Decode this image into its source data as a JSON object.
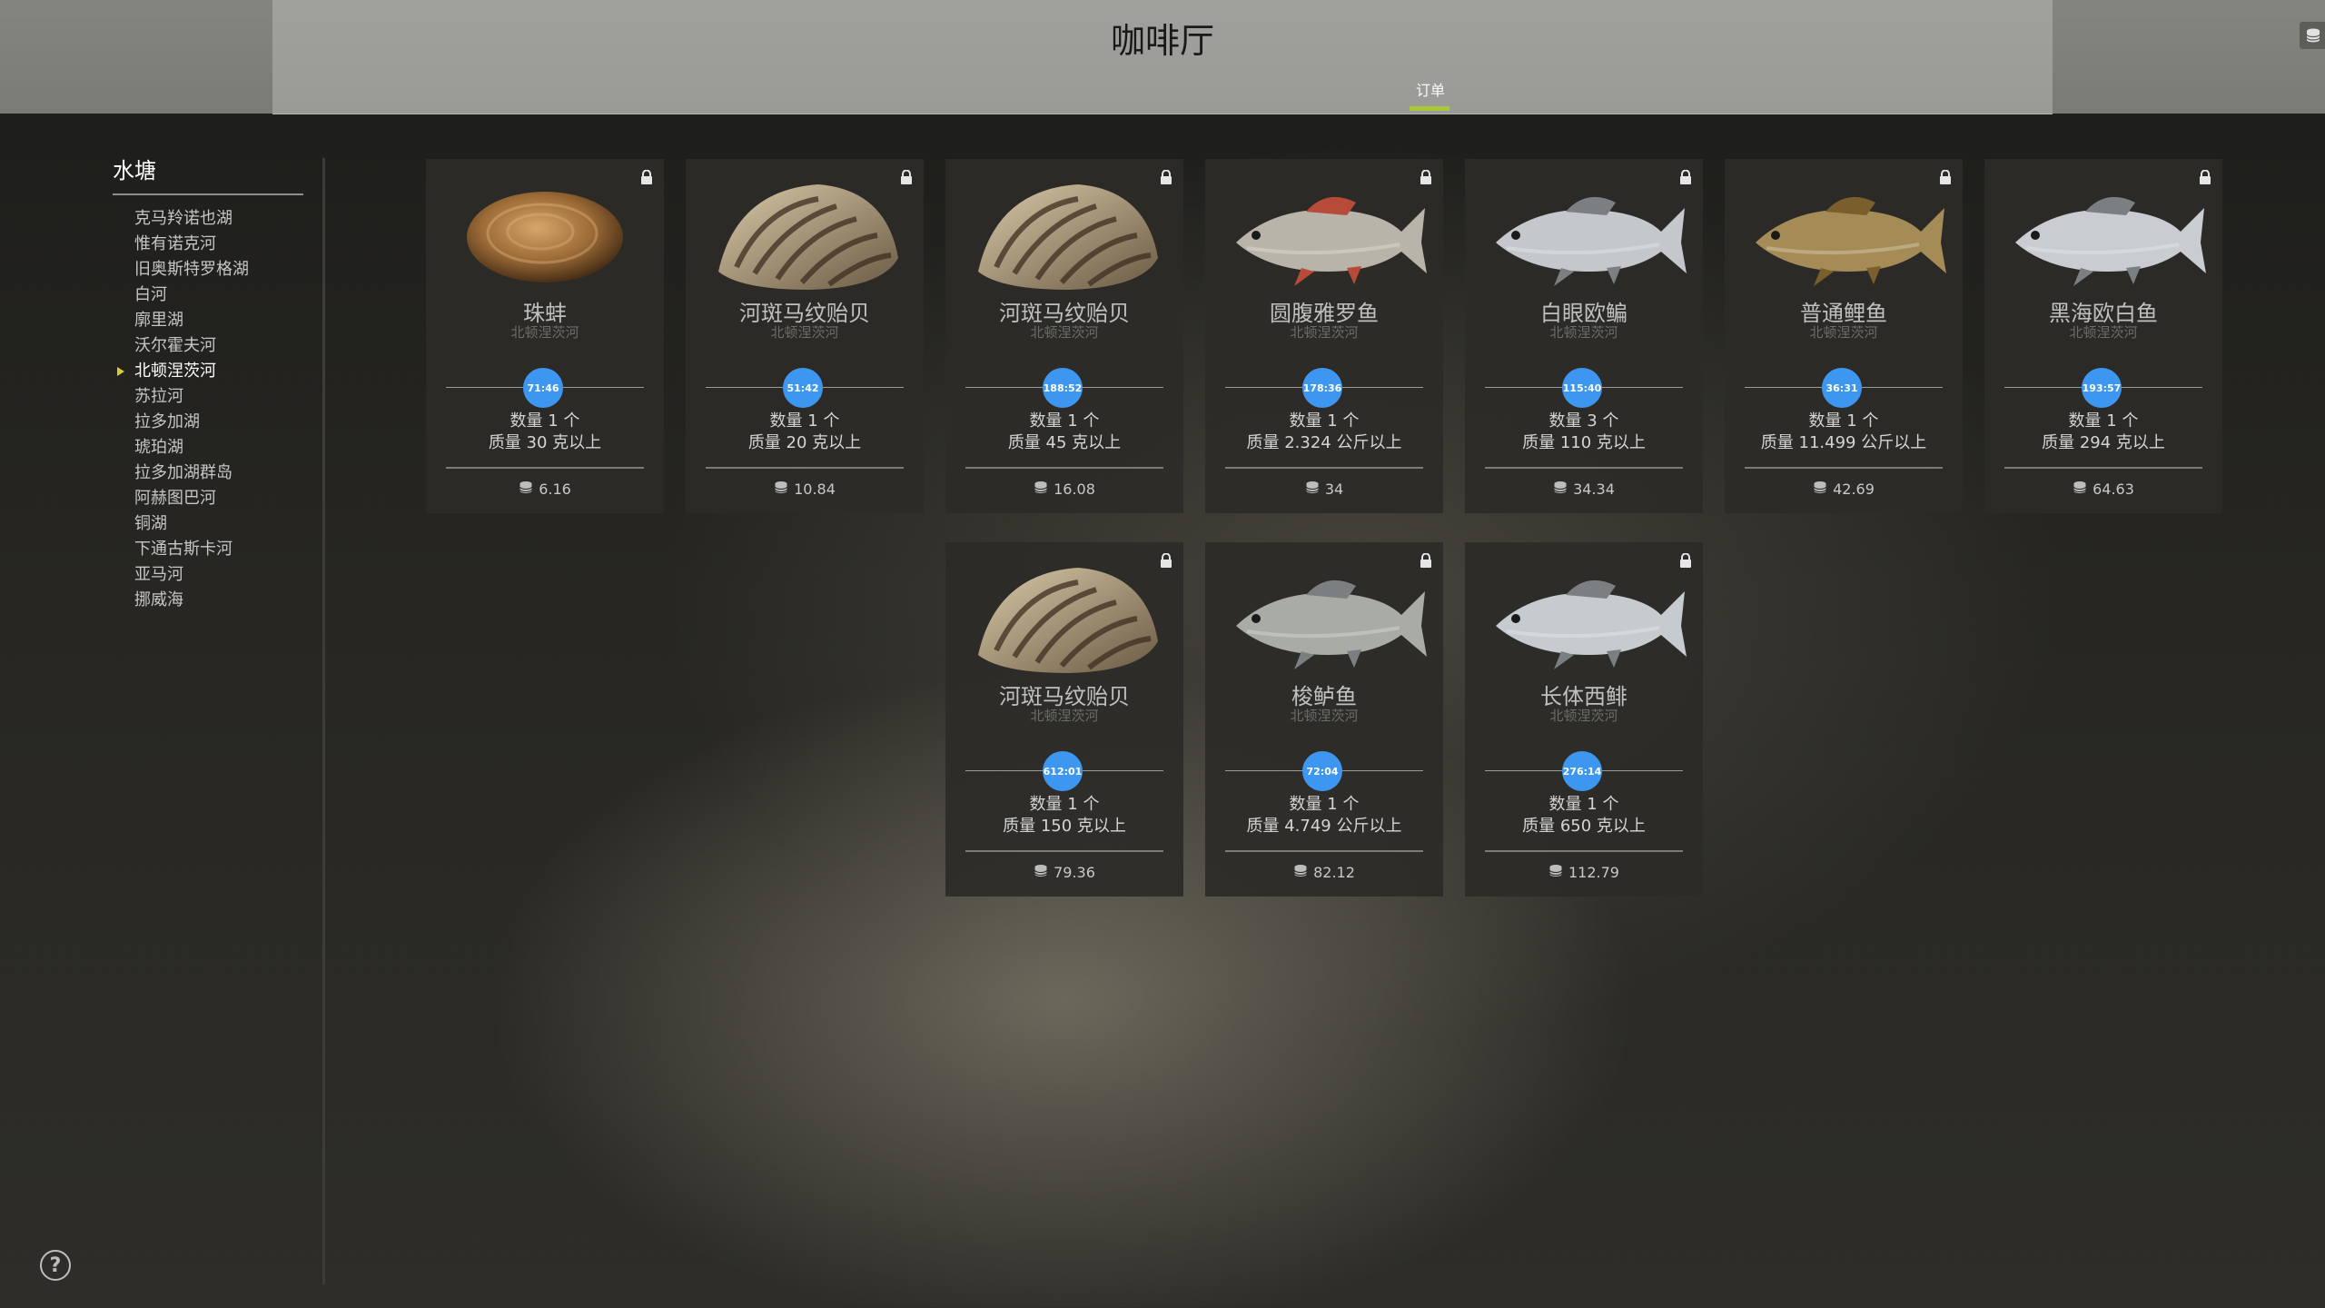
{
  "header": {
    "title": "咖啡厅",
    "tab_orders": "订单",
    "coin_icon": "coin-stack-icon"
  },
  "sidebar": {
    "title": "水塘",
    "items": [
      {
        "label": "克马羚诺也湖"
      },
      {
        "label": "惟有诺克河"
      },
      {
        "label": "旧奥斯特罗格湖"
      },
      {
        "label": "白河"
      },
      {
        "label": "廓里湖"
      },
      {
        "label": "沃尔霍夫河"
      },
      {
        "label": "北顿涅茨河"
      },
      {
        "label": "苏拉河"
      },
      {
        "label": "拉多加湖"
      },
      {
        "label": "琥珀湖"
      },
      {
        "label": "拉多加湖群岛"
      },
      {
        "label": "阿赫图巴河"
      },
      {
        "label": "铜湖"
      },
      {
        "label": "下通古斯卡河"
      },
      {
        "label": "亚马河"
      },
      {
        "label": "挪威海"
      }
    ],
    "active_index": 6
  },
  "orders": [
    {
      "name": "珠蚌",
      "location": "北顿涅茨河",
      "timer": "71:46",
      "quantity": "数量 1 个",
      "mass": "质量 30 克以上",
      "price": "6.16",
      "art": "clam"
    },
    {
      "name": "河斑马纹贻贝",
      "location": "北顿涅茨河",
      "timer": "51:42",
      "quantity": "数量 1 个",
      "mass": "质量 20 克以上",
      "price": "10.84",
      "art": "mussel"
    },
    {
      "name": "河斑马纹贻贝",
      "location": "北顿涅茨河",
      "timer": "188:52",
      "quantity": "数量 1 个",
      "mass": "质量 45 克以上",
      "price": "16.08",
      "art": "mussel"
    },
    {
      "name": "圆腹雅罗鱼",
      "location": "北顿涅茨河",
      "timer": "178:36",
      "quantity": "数量 1 个",
      "mass": "质量 2.324 公斤以上",
      "price": "34",
      "art": "roach"
    },
    {
      "name": "白眼欧鳊",
      "location": "北顿涅茨河",
      "timer": "115:40",
      "quantity": "数量 3 个",
      "mass": "质量 110 克以上",
      "price": "34.34",
      "art": "bream"
    },
    {
      "name": "普通鲤鱼",
      "location": "北顿涅茨河",
      "timer": "36:31",
      "quantity": "数量 1 个",
      "mass": "质量 11.499 公斤以上",
      "price": "42.69",
      "art": "carp"
    },
    {
      "name": "黑海欧白鱼",
      "location": "北顿涅茨河",
      "timer": "193:57",
      "quantity": "数量 1 个",
      "mass": "质量 294 克以上",
      "price": "64.63",
      "art": "bleak"
    },
    {
      "name": "河斑马纹贻贝",
      "location": "北顿涅茨河",
      "timer": "612:01",
      "quantity": "数量 1 个",
      "mass": "质量 150 克以上",
      "price": "79.36",
      "art": "mussel"
    },
    {
      "name": "梭鲈鱼",
      "location": "北顿涅茨河",
      "timer": "72:04",
      "quantity": "数量 1 个",
      "mass": "质量 4.749 公斤以上",
      "price": "82.12",
      "art": "zander"
    },
    {
      "name": "长体西鲱",
      "location": "北顿涅茨河",
      "timer": "276:14",
      "quantity": "数量 1 个",
      "mass": "质量 650 克以上",
      "price": "112.79",
      "art": "shad"
    }
  ]
}
